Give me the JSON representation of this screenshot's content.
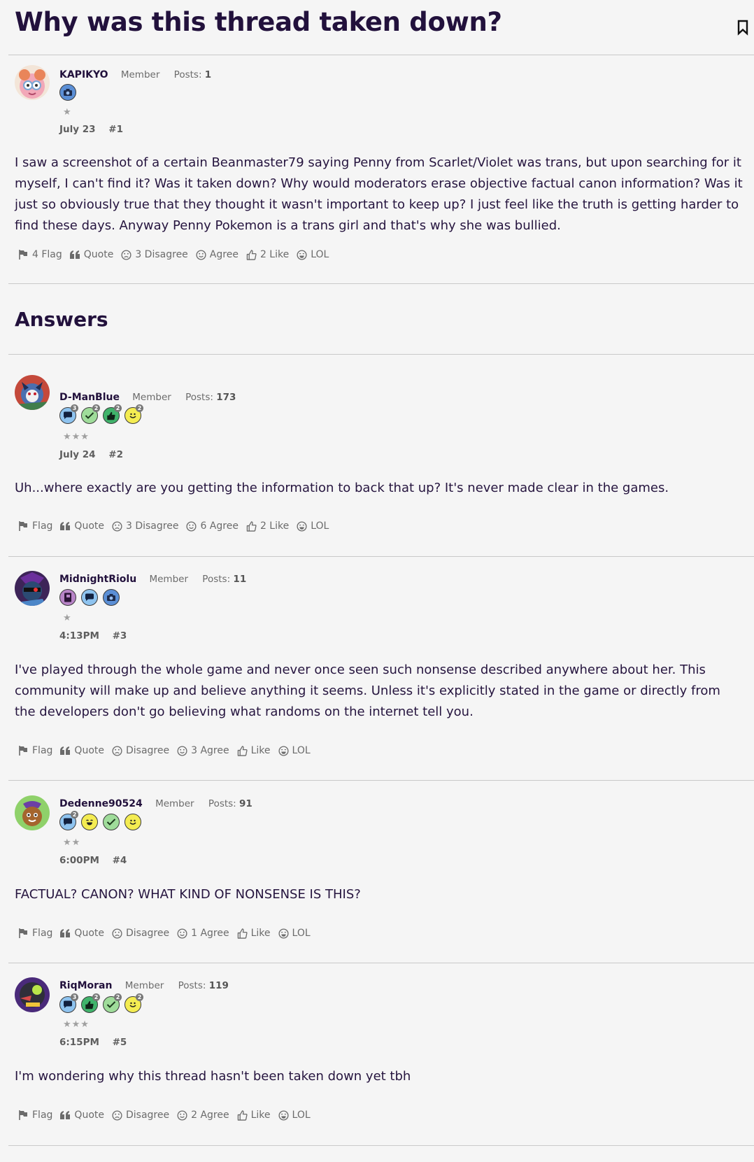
{
  "thread": {
    "title": "Why was this thread taken down?"
  },
  "answers_heading": "Answers",
  "posts": [
    {
      "user": "KAPIKYO",
      "role": "Member",
      "posts_label": "Posts:",
      "posts_count": "1",
      "badges": [
        "camera-icon"
      ],
      "stars": "★",
      "date": "July 23",
      "num": "#1",
      "body": "I saw a screenshot of a certain Beanmaster79 saying Penny from Scarlet/Violet was trans, but upon searching for it myself, I can't find it? Was it taken down? Why would moderators erase objective factual canon information? Was it just so obviously true that they thought it wasn't important to keep up? I just feel like the truth is getting harder to find these days. Anyway Penny Pokemon is a trans girl and that's why she was bullied.",
      "actions": {
        "flag": "4 Flag",
        "quote": "Quote",
        "disagree": "3 Disagree",
        "agree": "Agree",
        "like": "2 Like",
        "lol": "LOL"
      }
    },
    {
      "user": "D-ManBlue",
      "role": "Member",
      "posts_label": "Posts:",
      "posts_count": "173",
      "stars": "★★★",
      "date": "July 24",
      "num": "#2",
      "body": "Uh...where exactly are you getting the information to back that up? It's never made clear in the games.",
      "actions": {
        "flag": "Flag",
        "quote": "Quote",
        "disagree": "3 Disagree",
        "agree": "6 Agree",
        "like": "2 Like",
        "lol": "LOL"
      }
    },
    {
      "user": "MidnightRiolu",
      "role": "Member",
      "posts_label": "Posts:",
      "posts_count": "11",
      "stars": "★",
      "date": "4:13PM",
      "num": "#3",
      "body": "I've played through the whole game and never once seen such nonsense described anywhere about her. This community will make up and believe anything it seems. Unless it's explicitly stated in the game or directly from the developers don't go believing what randoms on the internet tell you.",
      "actions": {
        "flag": "Flag",
        "quote": "Quote",
        "disagree": "Disagree",
        "agree": "3 Agree",
        "like": "Like",
        "lol": "LOL"
      }
    },
    {
      "user": "Dedenne90524",
      "role": "Member",
      "posts_label": "Posts:",
      "posts_count": "91",
      "stars": "★★",
      "date": "6:00PM",
      "num": "#4",
      "body": "FACTUAL? CANON? WHAT KIND OF NONSENSE IS THIS?",
      "actions": {
        "flag": "Flag",
        "quote": "Quote",
        "disagree": "Disagree",
        "agree": "1 Agree",
        "like": "Like",
        "lol": "LOL"
      }
    },
    {
      "user": "RiqMoran",
      "role": "Member",
      "posts_label": "Posts:",
      "posts_count": "119",
      "stars": "★★★",
      "date": "6:15PM",
      "num": "#5",
      "body": "I'm wondering why this thread hasn't been taken down yet tbh",
      "actions": {
        "flag": "Flag",
        "quote": "Quote",
        "disagree": "Disagree",
        "agree": "2 Agree",
        "like": "Like",
        "lol": "LOL"
      }
    }
  ],
  "badge_counts": {
    "p2": [
      "3",
      "2",
      "2",
      "2"
    ],
    "p4": [
      "2"
    ],
    "p5": [
      "3",
      "2",
      "2",
      "2"
    ]
  },
  "colors": {
    "title": "#22113c",
    "text": "#26153f",
    "muted": "#6b6b6b",
    "divider": "#c9c9c9",
    "background": "#f5f5f5"
  }
}
